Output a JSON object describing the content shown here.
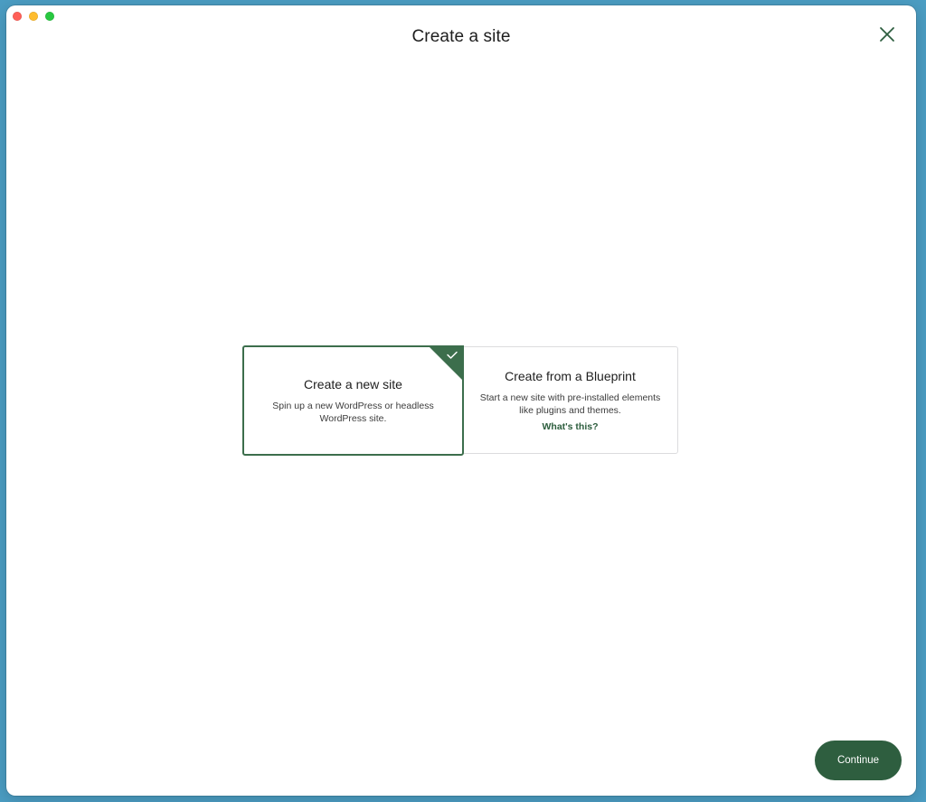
{
  "page": {
    "title": "Create a site"
  },
  "options": [
    {
      "title": "Create a new site",
      "description": "Spin up a new WordPress or headless WordPress site.",
      "selected": true
    },
    {
      "title": "Create from a Blueprint",
      "description": "Start a new site with pre-installed elements like plugins and themes.",
      "link": "What's this?",
      "selected": false
    }
  ],
  "footer": {
    "continue_label": "Continue"
  },
  "colors": {
    "accent": "#2e5e3f",
    "selected_border": "#3c6e4c",
    "background": "#4b9dc3"
  },
  "icons": {
    "close": "close-icon",
    "check": "check-icon"
  }
}
